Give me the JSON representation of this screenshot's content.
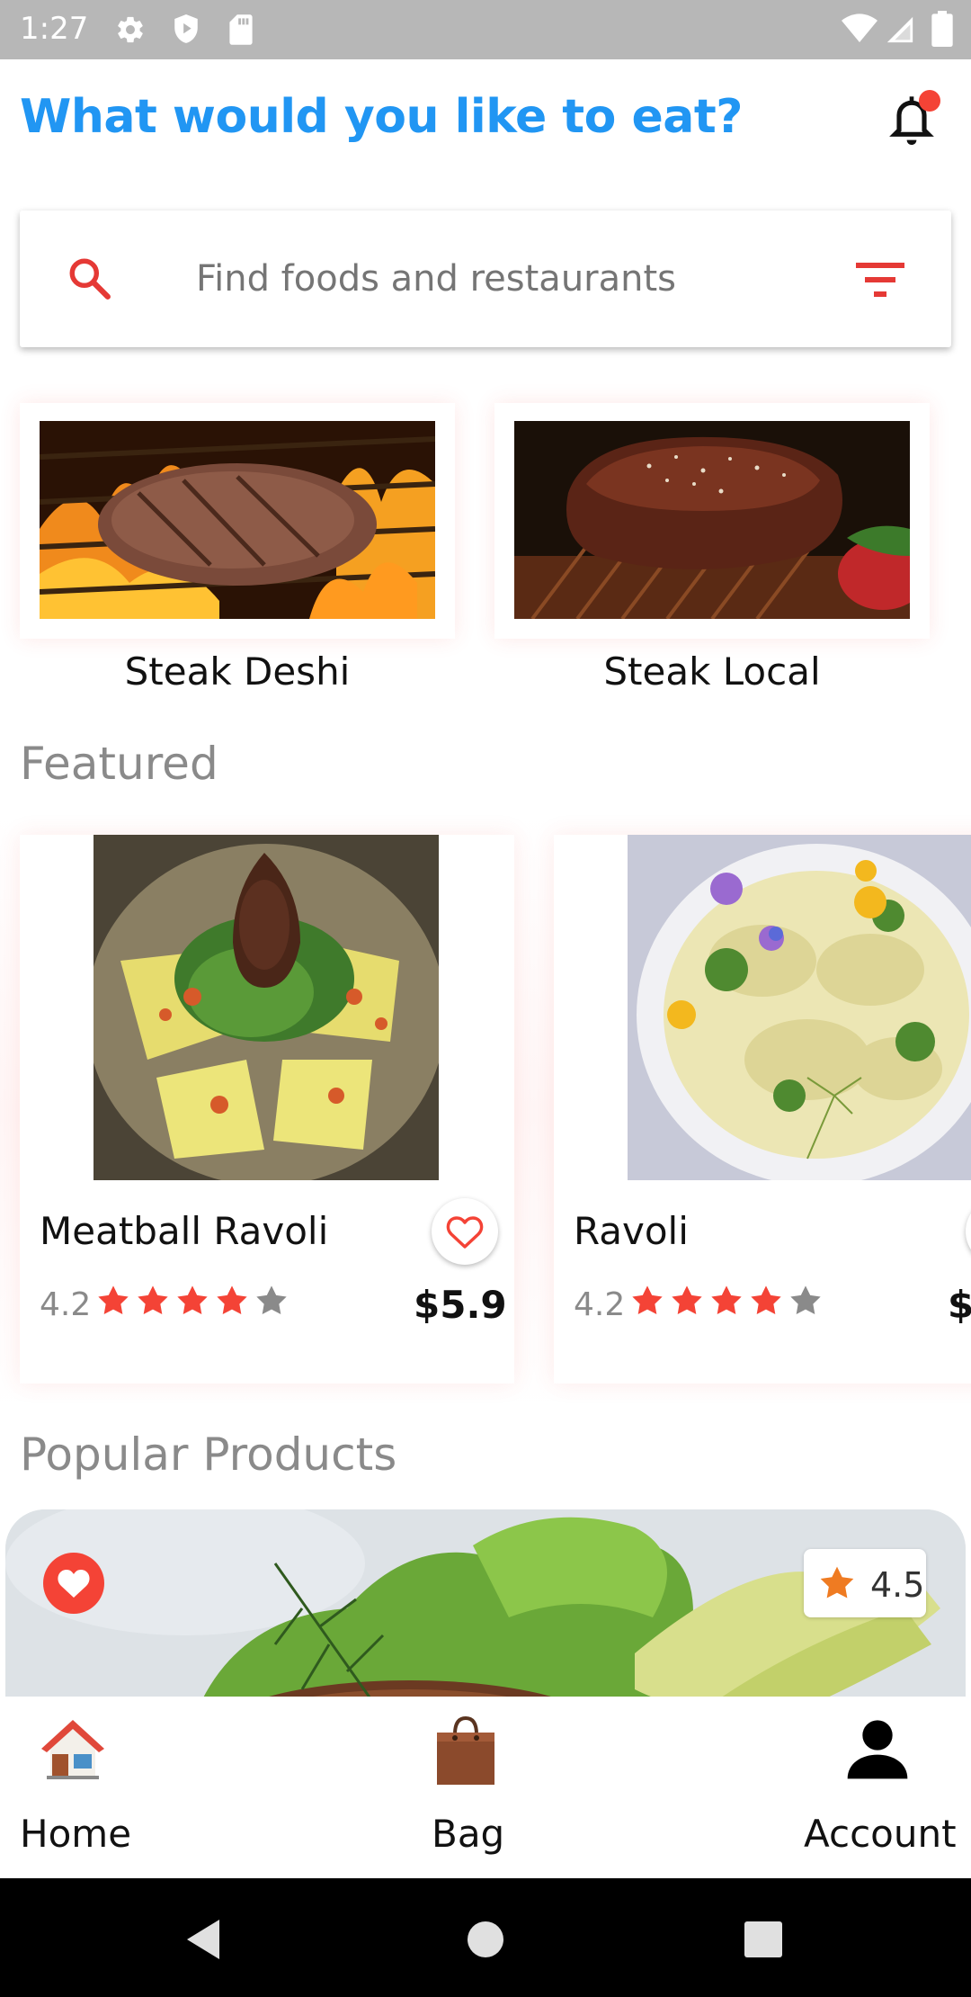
{
  "status_bar": {
    "time": "1:27",
    "icons": [
      "gear-icon",
      "shield-play-icon",
      "sd-card-icon",
      "wifi-icon",
      "signal-icon",
      "battery-icon"
    ]
  },
  "header": {
    "title": "What would you like to eat?",
    "notification_icon": "bell-icon",
    "has_notification_dot": true
  },
  "search": {
    "placeholder": "Find foods and restaurants",
    "value": "",
    "search_icon": "search-icon",
    "filter_icon": "filter-icon"
  },
  "categories": [
    {
      "label": "Steak Deshi"
    },
    {
      "label": "Steak Local"
    }
  ],
  "featured": {
    "title": "Featured",
    "items": [
      {
        "name": "Meatball Ravoli",
        "rating": "4.2",
        "stars": 4,
        "price": "$5.9"
      },
      {
        "name": "Ravoli",
        "rating": "4.2",
        "stars": 4,
        "price": "$"
      }
    ]
  },
  "popular": {
    "title": "Popular Products",
    "items": [
      {
        "rating": "4.5"
      }
    ]
  },
  "bottom_nav": [
    {
      "label": "Home",
      "icon": "home-icon"
    },
    {
      "label": "Bag",
      "icon": "bag-icon"
    },
    {
      "label": "Account",
      "icon": "account-icon"
    }
  ],
  "system_nav": [
    "back-icon",
    "home-circle-icon",
    "recents-icon"
  ],
  "colors": {
    "title_blue": "#2196f3",
    "accent_red": "#f44336",
    "star_gray": "#8a8a8a",
    "popular_star": "#ef7b22"
  }
}
